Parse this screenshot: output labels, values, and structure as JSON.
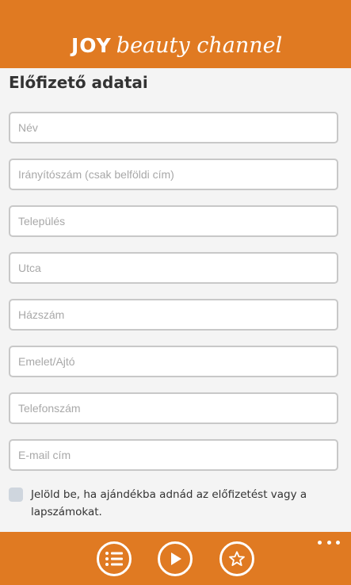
{
  "app": {
    "logo_text_joy": "JOY",
    "logo_text_rest": "beauty channel",
    "accent_color": "#e07a22"
  },
  "form": {
    "title": "Előfizető adatai",
    "fields": [
      {
        "placeholder": "Név",
        "value": ""
      },
      {
        "placeholder": "Irányítószám (csak belföldi cím)",
        "value": ""
      },
      {
        "placeholder": "Település",
        "value": ""
      },
      {
        "placeholder": "Utca",
        "value": ""
      },
      {
        "placeholder": "Házszám",
        "value": ""
      },
      {
        "placeholder": "Emelet/Ajtó",
        "value": ""
      },
      {
        "placeholder": "Telefonszám",
        "value": ""
      },
      {
        "placeholder": "E-mail cím",
        "value": ""
      }
    ],
    "gift_checkbox": {
      "label": "Jelöld be, ha ajándékba adnád az előfizetést vagy a lapszámokat.",
      "checked": false
    }
  },
  "app_bar": {
    "buttons": [
      {
        "icon": "list-icon"
      },
      {
        "icon": "play-icon"
      },
      {
        "icon": "star-icon"
      }
    ],
    "more_icon": "more-icon"
  }
}
